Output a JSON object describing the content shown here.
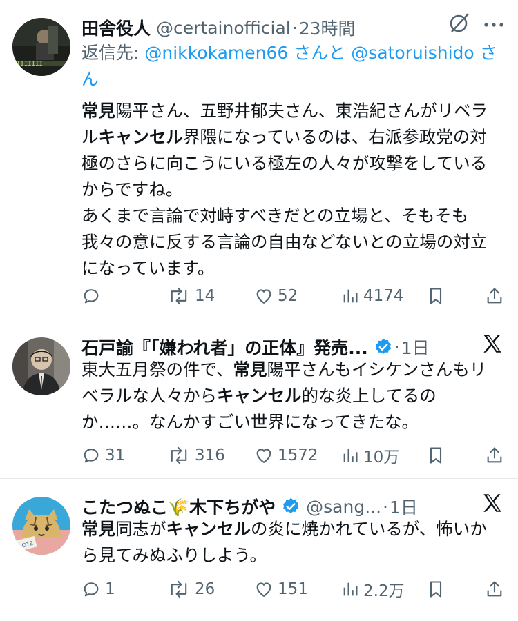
{
  "tweets": [
    {
      "name": "田舎役人",
      "handle": "@certainofficial",
      "dot": "·",
      "time": "23時間",
      "reply_prefix": "返信先: ",
      "reply_user1": "@nikkokamen66",
      "reply_mid": " さんと ",
      "reply_user2": "@satoruishido",
      "reply_suffix": " さん",
      "body": [
        {
          "text": "常見",
          "bold": true
        },
        {
          "text": "陽平さん、五野井郁夫さん、東浩紀さんがリベラル",
          "bold": false
        },
        {
          "text": "キャンセル",
          "bold": true
        },
        {
          "text": "界隈になっているのは、右派参政党の対極のさらに向こうにいる極左の人々が攻撃をしているからですね。",
          "bold": false
        },
        {
          "text": "\nあくまで言論で対峙すべきだとの立場と、そもそも我々の意に反する言論の自由などないとの立場の対立になっています。",
          "bold": false
        }
      ],
      "replies": "",
      "retweets": "14",
      "likes": "52",
      "views": "4174"
    },
    {
      "name": "石戸諭『「嫌われ者」の正体』発売...",
      "dot": "·",
      "time": "1日",
      "body": [
        {
          "text": "東大五月祭の件で、",
          "bold": false
        },
        {
          "text": "常見",
          "bold": true
        },
        {
          "text": "陽平さんもイシケンさんもリベラルな人々から",
          "bold": false
        },
        {
          "text": "キャンセル",
          "bold": true
        },
        {
          "text": "的な炎上してるのか……。なんかすごい世界になってきたな。",
          "bold": false
        }
      ],
      "replies": "31",
      "retweets": "316",
      "likes": "1572",
      "views": "10万"
    },
    {
      "name": "こたつぬこ🌾木下ちがや",
      "handle": "@sang...",
      "dot": "·",
      "time": "1日",
      "body": [
        {
          "text": "常見",
          "bold": true
        },
        {
          "text": "同志が",
          "bold": false
        },
        {
          "text": "キャンセル",
          "bold": true
        },
        {
          "text": "の炎に焼かれているが、怖いから見てみぬふりしよう。",
          "bold": false
        }
      ],
      "replies": "1",
      "retweets": "26",
      "likes": "151",
      "views": "2.2万"
    }
  ],
  "colors": {
    "text": "#0f1419",
    "secondary": "#536471",
    "link": "#1d9bf0",
    "verified": "#1d9bf0",
    "divider": "#e6e6e6"
  },
  "icons": [
    "reply-icon",
    "retweet-icon",
    "like-icon",
    "views-icon",
    "bookmark-icon",
    "share-icon",
    "grok-icon",
    "more-icon",
    "x-logo-icon",
    "verified-badge-icon"
  ]
}
